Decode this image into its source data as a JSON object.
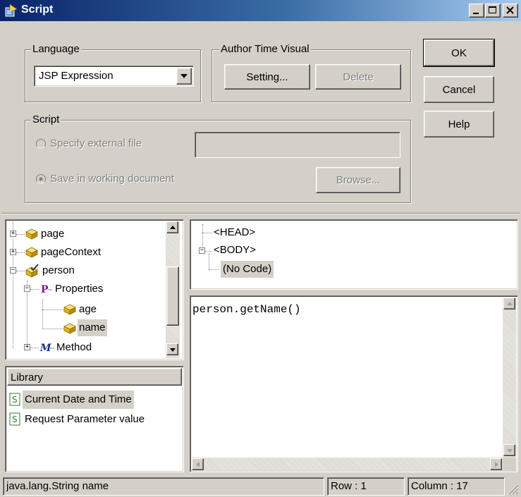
{
  "window": {
    "title": "Script"
  },
  "language": {
    "group_label": "Language",
    "selected": "JSP Expression"
  },
  "author_time_visual": {
    "group_label": "Author Time Visual",
    "setting_label": "Setting...",
    "delete_label": "Delete"
  },
  "buttons": {
    "ok": "OK",
    "cancel": "Cancel",
    "help": "Help"
  },
  "script": {
    "group_label": "Script",
    "external_label": "Specify external file",
    "external_value": "",
    "working_label": "Save in working document",
    "browse_label": "Browse..."
  },
  "object_tree": {
    "items": [
      {
        "label": "page"
      },
      {
        "label": "pageContext"
      },
      {
        "label": "person"
      },
      {
        "label": "Properties"
      },
      {
        "label": "age"
      },
      {
        "label": "name"
      },
      {
        "label": "Method"
      }
    ]
  },
  "library": {
    "header": "Library",
    "items": [
      {
        "label": "Current Date and Time"
      },
      {
        "label": "Request Parameter value"
      }
    ]
  },
  "doc_tree": {
    "items": [
      {
        "label": "<HEAD>"
      },
      {
        "label": "<BODY>"
      },
      {
        "label": "(No Code)"
      }
    ]
  },
  "code": {
    "text": "person.getName()"
  },
  "status": {
    "info": "java.lang.String name",
    "row": "Row : 1",
    "column": "Column : 17"
  },
  "colors": {
    "titlebar_start": "#0a246a",
    "titlebar_end": "#a6caf0",
    "face": "#d4d0c8",
    "selection": "#d4d0c8"
  },
  "icons": {
    "title": "script-window-icon",
    "object": "yellow-cube-icon",
    "person": "object-check-icon",
    "properties": "property-p-icon",
    "method": "method-m-icon",
    "library_item": "script-s-icon"
  }
}
